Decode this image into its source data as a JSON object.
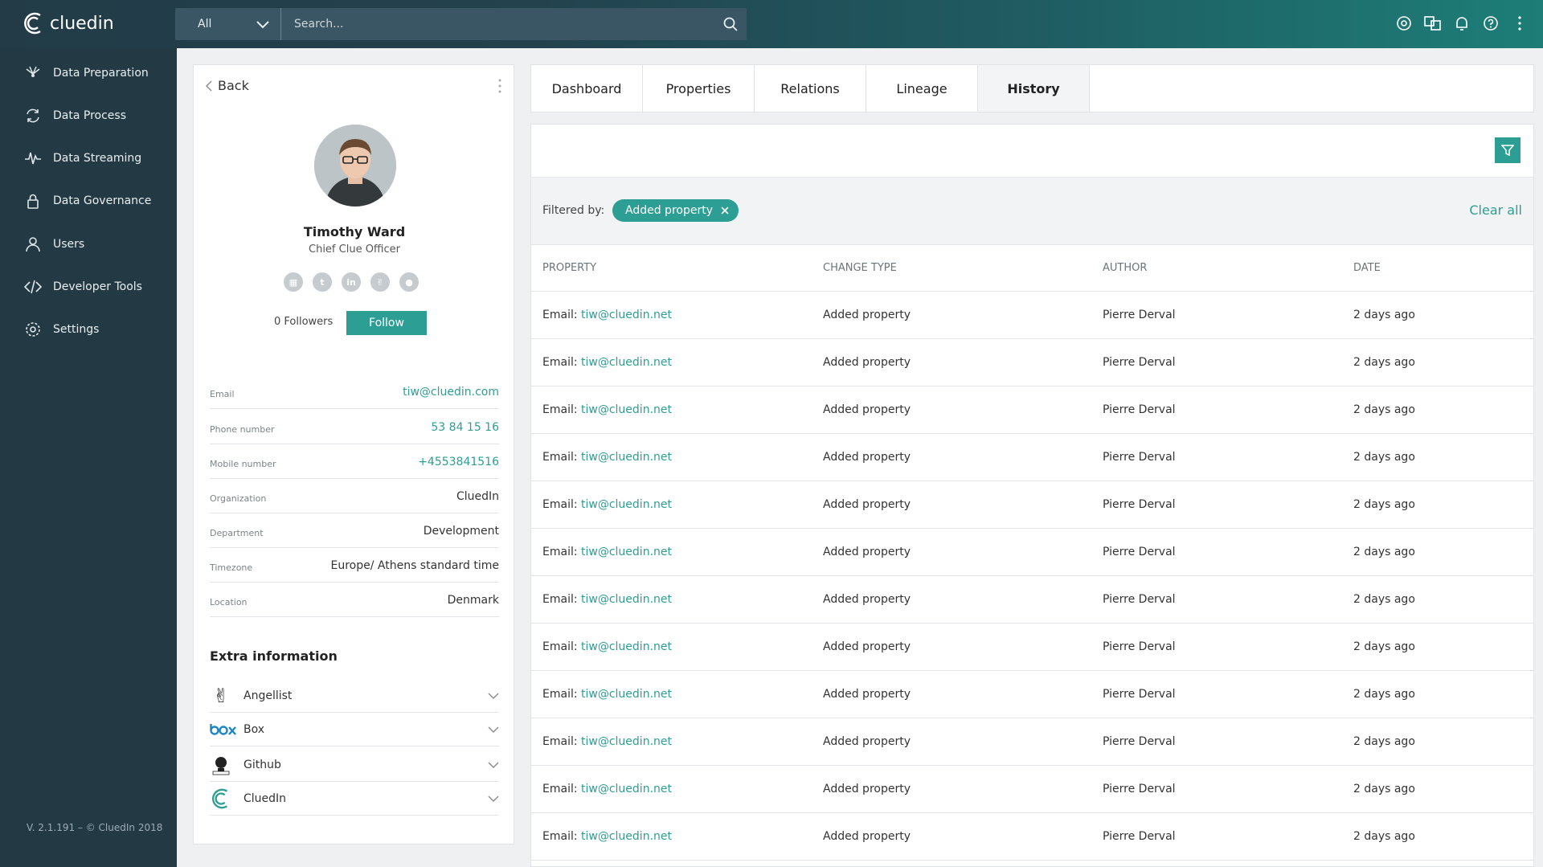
{
  "brand": {
    "name": "cluedin"
  },
  "search": {
    "scope": "All",
    "placeholder": "Search..."
  },
  "sidebar": {
    "items": [
      {
        "label": "Data Preparation"
      },
      {
        "label": "Data Process"
      },
      {
        "label": "Data Streaming"
      },
      {
        "label": "Data Governance"
      },
      {
        "label": "Users"
      },
      {
        "label": "Developer Tools"
      },
      {
        "label": "Settings"
      }
    ],
    "version": "V. 2.1.191 – © CluedIn  2018"
  },
  "profile": {
    "back_label": "Back",
    "name": "Timothy Ward",
    "title": "Chief Clue Officer",
    "followers": "0 Followers",
    "follow_label": "Follow",
    "fields": [
      {
        "label": "Email",
        "value": "tiw@cluedin.com"
      },
      {
        "label": "Phone number",
        "value": "53 84 15 16"
      },
      {
        "label": "Mobile number",
        "value": "+4553841516"
      },
      {
        "label": "Organization",
        "value": "CluedIn"
      },
      {
        "label": "Department",
        "value": "Development"
      },
      {
        "label": "Timezone",
        "value": "Europe/ Athens standard time"
      },
      {
        "label": "Location",
        "value": "Denmark"
      }
    ],
    "extra_title": "Extra information",
    "extra": [
      {
        "label": "Angellist"
      },
      {
        "label": "Box"
      },
      {
        "label": "Github"
      },
      {
        "label": "CluedIn"
      }
    ]
  },
  "tabs": [
    {
      "label": "Dashboard"
    },
    {
      "label": "Properties"
    },
    {
      "label": "Relations"
    },
    {
      "label": "Lineage"
    },
    {
      "label": "History"
    }
  ],
  "history": {
    "filtered_by": "Filtered by:",
    "chip": "Added property",
    "clear_all": "Clear all",
    "columns": [
      "Property",
      "Change type",
      "Author",
      "Date"
    ],
    "rows": [
      {
        "prefix": "Email: ",
        "link": "tiw@cluedin.net",
        "change": "Added property",
        "author": "Pierre Derval",
        "date": "2 days ago"
      },
      {
        "prefix": "Email: ",
        "link": "tiw@cluedin.net",
        "change": "Added property",
        "author": "Pierre Derval",
        "date": "2 days ago"
      },
      {
        "prefix": "Email: ",
        "link": "tiw@cluedin.net",
        "change": "Added property",
        "author": "Pierre Derval",
        "date": "2 days ago"
      },
      {
        "prefix": "Email: ",
        "link": "tiw@cluedin.net",
        "change": "Added property",
        "author": "Pierre Derval",
        "date": "2 days ago"
      },
      {
        "prefix": "Email: ",
        "link": "tiw@cluedin.net",
        "change": "Added property",
        "author": "Pierre Derval",
        "date": "2 days ago"
      },
      {
        "prefix": "Email: ",
        "link": "tiw@cluedin.net",
        "change": "Added property",
        "author": "Pierre Derval",
        "date": "2 days ago"
      },
      {
        "prefix": "Email: ",
        "link": "tiw@cluedin.net",
        "change": "Added property",
        "author": "Pierre Derval",
        "date": "2 days ago"
      },
      {
        "prefix": "Email: ",
        "link": "tiw@cluedin.net",
        "change": "Added property",
        "author": "Pierre Derval",
        "date": "2 days ago"
      },
      {
        "prefix": "Email: ",
        "link": "tiw@cluedin.net",
        "change": "Added property",
        "author": "Pierre Derval",
        "date": "2 days ago"
      },
      {
        "prefix": "Email: ",
        "link": "tiw@cluedin.net",
        "change": "Added property",
        "author": "Pierre Derval",
        "date": "2 days ago"
      },
      {
        "prefix": "Email: ",
        "link": "tiw@cluedin.net",
        "change": "Added property",
        "author": "Pierre Derval",
        "date": "2 days ago"
      },
      {
        "prefix": "Email: ",
        "link": "tiw@cluedin.net",
        "change": "Added property",
        "author": "Pierre Derval",
        "date": "2 days ago"
      }
    ]
  },
  "colors": {
    "accent": "#2c9e93",
    "sidebar": "#233a45"
  }
}
